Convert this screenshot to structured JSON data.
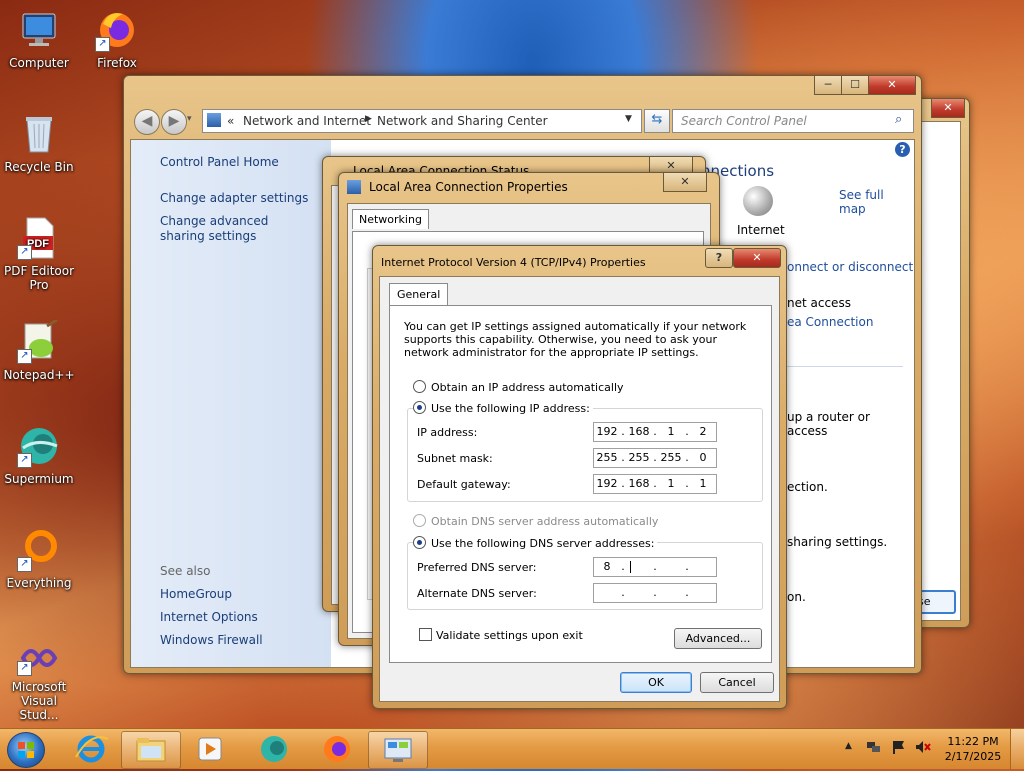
{
  "desktop": {
    "icons": [
      {
        "label": "Computer"
      },
      {
        "label": "Firefox"
      },
      {
        "label": "Recycle Bin"
      },
      {
        "label": "PDF Editoor Pro"
      },
      {
        "label": "Notepad++"
      },
      {
        "label": "Supermium"
      },
      {
        "label": "Everything"
      },
      {
        "label": "Microsoft Visual Stud..."
      }
    ],
    "pdf_icon_text": "PDF"
  },
  "control_panel": {
    "breadcrumb": [
      "«",
      "Network and Internet",
      "Network and Sharing Center"
    ],
    "search_placeholder": "Search Control Panel",
    "left_links": [
      "Control Panel Home",
      "Change adapter settings",
      "Change advanced sharing settings"
    ],
    "see_also_title": "See also",
    "see_also_links": [
      "HomeGroup",
      "Internet Options",
      "Windows Firewall"
    ],
    "partial": {
      "connections": "nnections",
      "see_full_map": "See full map",
      "internet": "Internet",
      "connect_disconnect": "onnect or disconnect",
      "access_type": "net access",
      "area_connection": "ea Connection",
      "router_text": "up a router or access",
      "ection_text": "ection.",
      "sharing_text": "sharing settings.",
      "on_text": "on.",
      "close_fragment": "se"
    }
  },
  "status_window": {
    "title": "Local Area Connection Status"
  },
  "properties_window": {
    "title": "Local Area Connection Properties",
    "tab": "Networking"
  },
  "ipv4_dialog": {
    "title": "Internet Protocol Version 4 (TCP/IPv4) Properties",
    "tab": "General",
    "description": "You can get IP settings assigned automatically if your network supports this capability. Otherwise, you need to ask your network administrator for the appropriate IP settings.",
    "obtain_ip_auto": "Obtain an IP address automatically",
    "use_following_ip": "Use the following IP address:",
    "ip_label": "IP address:",
    "ip_value": [
      "192",
      "168",
      "1",
      "2"
    ],
    "subnet_label": "Subnet mask:",
    "subnet_value": [
      "255",
      "255",
      "255",
      "0"
    ],
    "gateway_label": "Default gateway:",
    "gateway_value": [
      "192",
      "168",
      "1",
      "1"
    ],
    "obtain_dns_auto": "Obtain DNS server address automatically",
    "use_following_dns": "Use the following DNS server addresses:",
    "preferred_dns_label": "Preferred DNS server:",
    "preferred_dns_value": [
      "8",
      "",
      "",
      ""
    ],
    "alternate_dns_label": "Alternate DNS server:",
    "alternate_dns_value": [
      "",
      "",
      "",
      ""
    ],
    "validate_label": "Validate settings upon exit",
    "advanced_button": "Advanced...",
    "ok_button": "OK",
    "cancel_button": "Cancel",
    "help_button": "?",
    "close_button": "✕"
  },
  "taskbar": {
    "time": "11:22 PM",
    "date": "2/17/2025"
  }
}
